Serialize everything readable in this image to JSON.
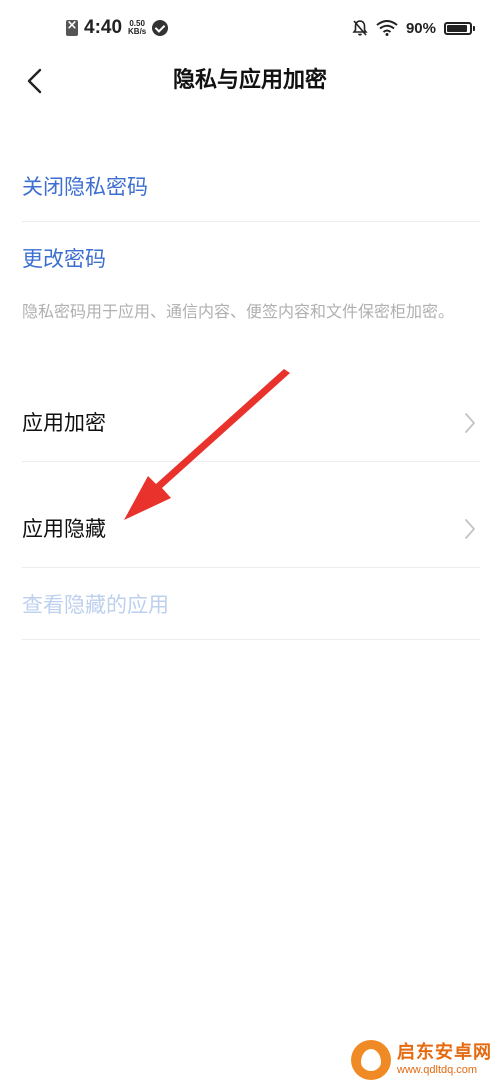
{
  "status_bar": {
    "time": "4:40",
    "net_speed_value": "0.50",
    "net_speed_unit": "KB/s",
    "battery_percent": "90%",
    "battery_level": 0.9
  },
  "header": {
    "title": "隐私与应用加密"
  },
  "items": {
    "disable_password": "关闭隐私密码",
    "change_password": "更改密码",
    "description": "隐私密码用于应用、通信内容、便签内容和文件保密柜加密。",
    "app_encryption": "应用加密",
    "app_hiding": "应用隐藏",
    "view_hidden_apps": "查看隐藏的应用"
  },
  "colors": {
    "link": "#3d6fd1",
    "disabled": "#bdd0ee",
    "annotation_arrow": "#e8322b",
    "watermark": "#e56a10"
  },
  "watermark": {
    "name": "启东安卓网",
    "url": "www.qdltdq.com"
  }
}
